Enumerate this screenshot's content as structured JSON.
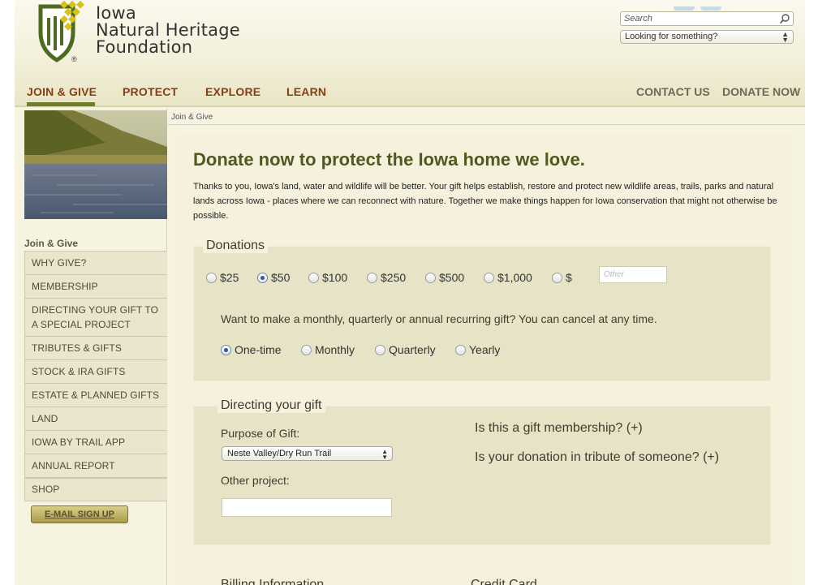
{
  "brand": {
    "line1": "Iowa",
    "line2": "Natural Heritage",
    "line3": "Foundation",
    "registered": "®"
  },
  "header": {
    "search_placeholder": "Search",
    "looking_select": "Looking for something?"
  },
  "nav": {
    "items": [
      "JOIN & GIVE",
      "PROTECT",
      "EXPLORE",
      "LEARN"
    ],
    "right": [
      "CONTACT US",
      "DONATE NOW"
    ]
  },
  "sidebar": {
    "heading": "Join & Give",
    "items": [
      "WHY GIVE?",
      "MEMBERSHIP",
      "DIRECTING YOUR GIFT TO A SPECIAL PROJECT",
      "TRIBUTES & GIFTS",
      "STOCK & IRA GIFTS",
      "ESTATE & PLANNED GIFTS",
      "LAND",
      "IOWA BY TRAIL APP",
      "ANNUAL REPORT",
      "SHOP"
    ],
    "email_button": "E-MAIL SIGN UP"
  },
  "breadcrumb": "Join & Give",
  "main": {
    "title": "Donate now to protect the Iowa home we love.",
    "intro": "Thanks to you, Iowa's land, water and wildlife will be better. Your gift helps establish, restore and protect new wildlife areas, trails, parks and natural lands across Iowa - places where we can reconnect with nature. Together we make things happen for Iowa conservation that might not otherwise be possible."
  },
  "donations": {
    "title": "Donations",
    "amounts": [
      "$25",
      "$50",
      "$100",
      "$250",
      "$500",
      "$1,000",
      "$"
    ],
    "selected_amount": "$50",
    "other_placeholder": "Other",
    "recurring_question": "Want to make a monthly, quarterly or annual recurring gift? You can cancel at any time.",
    "frequencies": [
      "One-time",
      "Monthly",
      "Quarterly",
      "Yearly"
    ],
    "selected_frequency": "One-time"
  },
  "directing": {
    "title": "Directing your gift",
    "purpose_label": "Purpose of Gift:",
    "purpose_value": "Neste Valley/Dry Run Trail",
    "other_label": "Other project:",
    "membership_question": "Is this a gift membership? (+)",
    "tribute_question": "Is your donation in tribute of someone? (+)"
  },
  "below": {
    "billing": "Billing Information",
    "credit": "Credit Card"
  },
  "colors": {
    "nav_text": "#8a3d12",
    "title_green": "#4f5a1f",
    "nav_underline": "#6f7c2e",
    "panel_bg": "#e7e3c7"
  }
}
